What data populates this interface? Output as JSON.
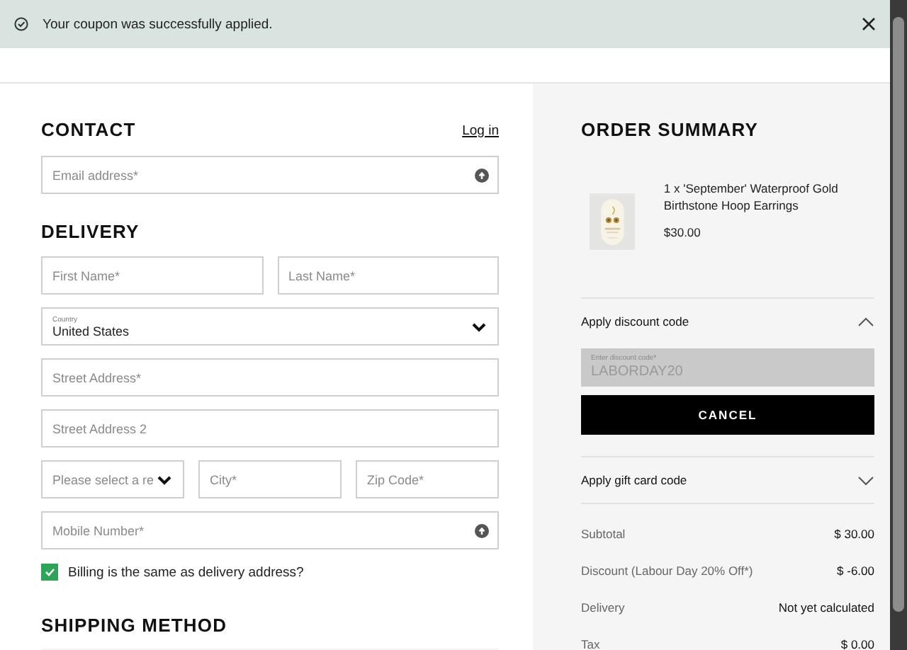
{
  "notification": {
    "message": "Your coupon was successfully applied."
  },
  "contact": {
    "title": "CONTACT",
    "login": "Log in",
    "email": {
      "kind": "input",
      "placeholder": "Email address*",
      "info": true
    }
  },
  "delivery": {
    "title": "DELIVERY",
    "rows": [
      {
        "fields": [
          {
            "kind": "input",
            "placeholder": "First Name*"
          },
          {
            "kind": "input",
            "placeholder": "Last Name*"
          }
        ]
      },
      {
        "fields": [
          {
            "kind": "select",
            "label": "Country",
            "value": "United States"
          }
        ]
      },
      {
        "fields": [
          {
            "kind": "input",
            "placeholder": "Street Address*"
          }
        ]
      },
      {
        "fields": [
          {
            "kind": "input",
            "placeholder": "Street Address 2"
          }
        ]
      },
      {
        "fields": [
          {
            "kind": "select",
            "placeholder": "Please select a re"
          },
          {
            "kind": "input",
            "placeholder": "City*"
          },
          {
            "kind": "input",
            "placeholder": "Zip Code*"
          }
        ]
      },
      {
        "fields": [
          {
            "kind": "input",
            "placeholder": "Mobile Number*",
            "info": true
          }
        ]
      }
    ],
    "billing_same": {
      "label": "Billing is the same as delivery address?",
      "checked": true
    }
  },
  "shipping": {
    "title": "SHIPPING METHOD"
  },
  "summary": {
    "title": "ORDER SUMMARY",
    "items": [
      {
        "name": "1 x 'September' Waterproof Gold Birthstone Hoop Earrings",
        "price": "$30.00"
      }
    ],
    "discount": {
      "title": "Apply discount code",
      "expanded": true,
      "label": "Enter discount code*",
      "value": "LABORDAY20",
      "disabled": true,
      "button": "CANCEL"
    },
    "gift_card": {
      "title": "Apply gift card code",
      "expanded": false
    },
    "totals": [
      {
        "label": "Subtotal",
        "value": "$ 30.00"
      },
      {
        "label": "Discount (Labour Day 20% Off*)",
        "value": "$ -6.00"
      },
      {
        "label": "Delivery",
        "value": "Not yet calculated"
      },
      {
        "label": "Tax",
        "value": "$ 0.00"
      }
    ]
  }
}
